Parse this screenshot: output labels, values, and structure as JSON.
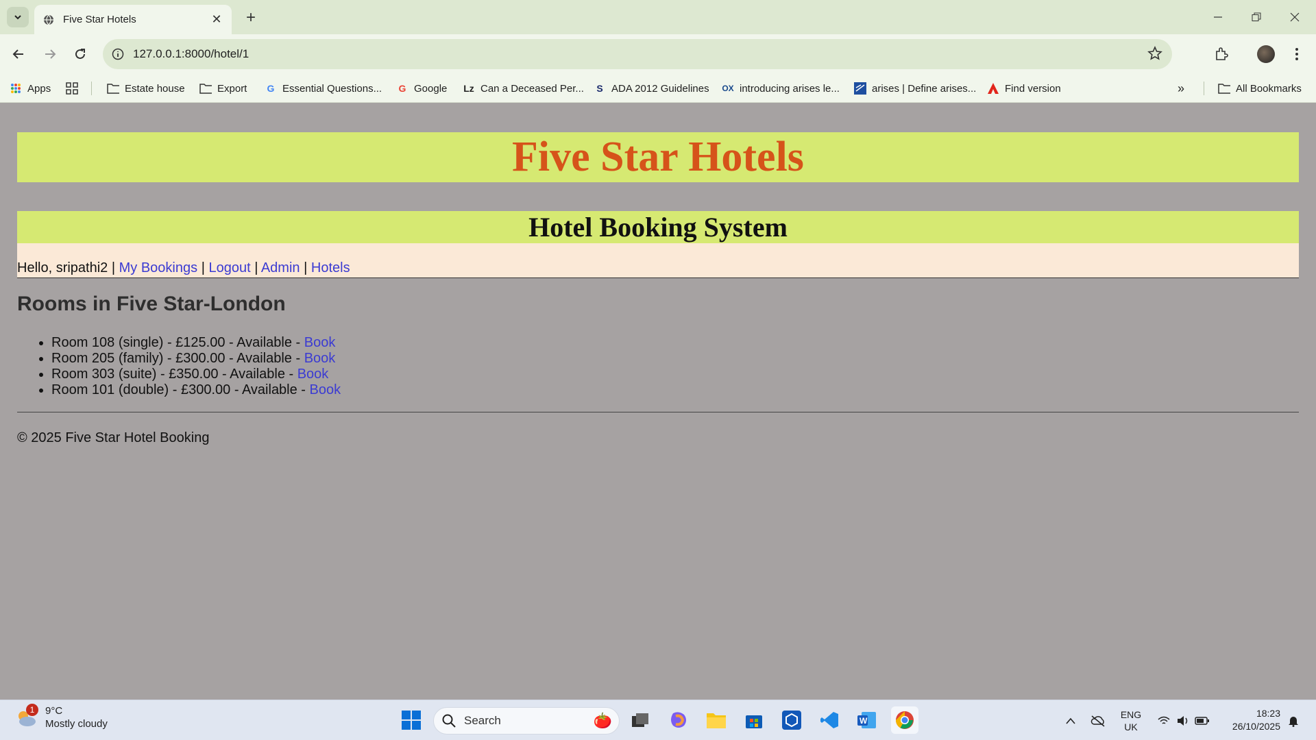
{
  "browser": {
    "tab_title": "Five Star Hotels",
    "url": "127.0.0.1:8000/hotel/1",
    "bookmarks": [
      {
        "label": "Apps",
        "icon": "apps-grid-icon"
      },
      {
        "label": "",
        "icon": "grid-icon"
      },
      {
        "label": "Estate house",
        "icon": "folder-icon"
      },
      {
        "label": "Export",
        "icon": "folder-icon"
      },
      {
        "label": "Essential Questions...",
        "icon": "google-icon"
      },
      {
        "label": "Google",
        "icon": "google-icon"
      },
      {
        "label": "Can a Deceased Per...",
        "icon": "lz-icon"
      },
      {
        "label": "ADA 2012 Guidelines",
        "icon": "ada-icon"
      },
      {
        "label": "introducing arises le...",
        "icon": "ox-icon"
      },
      {
        "label": "arises | Define arises...",
        "icon": "dictionary-icon"
      },
      {
        "label": "Find version",
        "icon": "adobe-icon"
      }
    ],
    "all_bookmarks": "All Bookmarks"
  },
  "page": {
    "banner_title": "Five Star Hotels",
    "subtitle": "Hotel Booking System",
    "user": {
      "greeting": "Hello, sripathi2",
      "sep": "|",
      "links": [
        "My Bookings",
        "Logout",
        "Admin",
        "Hotels"
      ]
    },
    "rooms_heading": "Rooms in Five Star-London",
    "rooms": [
      {
        "text": "Room 108 (single) - £125.00 - Available - ",
        "action": "Book"
      },
      {
        "text": "Room 205 (family) - £300.00 - Available - ",
        "action": "Book"
      },
      {
        "text": "Room 303 (suite) - £350.00 - Available - ",
        "action": "Book"
      },
      {
        "text": "Room 101 (double) - £300.00 - Available - ",
        "action": "Book"
      }
    ],
    "footer": "© 2025 Five Star Hotel Booking"
  },
  "taskbar": {
    "weather_temp": "9°C",
    "weather_desc": "Mostly cloudy",
    "weather_badge": "1",
    "search_label": "Search",
    "lang_top": "ENG",
    "lang_bottom": "UK",
    "time": "18:23",
    "date": "26/10/2025"
  },
  "colors": {
    "banner_bg": "#d6e972",
    "banner_text": "#d6531a",
    "page_bg": "#a6a2a2",
    "link": "#3b3bd2",
    "userbar_bg": "#fbe9d7"
  }
}
